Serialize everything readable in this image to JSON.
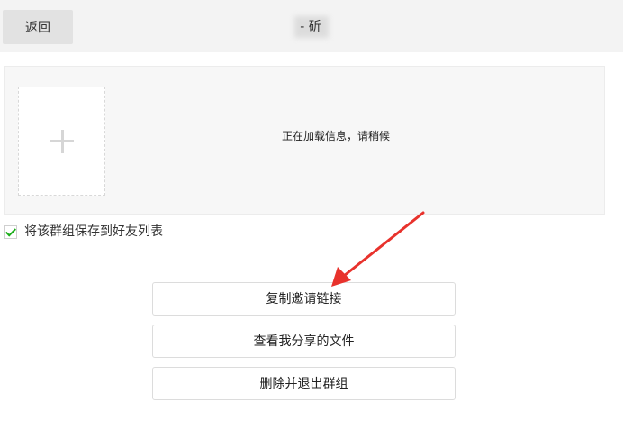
{
  "header": {
    "back_label": "返回",
    "title": "-              斫"
  },
  "info_panel": {
    "loading_text": "正在加载信息，请稍候"
  },
  "save_option": {
    "label": "将该群组保存到好友列表",
    "checked": true,
    "check_color": "#1aad19"
  },
  "actions": {
    "copy_invite_link": "复制邀请链接",
    "view_my_shared_files": "查看我分享的文件",
    "delete_and_leave_group": "删除并退出群组"
  },
  "annotation": {
    "arrow_color": "#e8322c"
  },
  "icons": {
    "avatar_upload": "plus-icon",
    "checkbox": "checkmark-icon"
  }
}
